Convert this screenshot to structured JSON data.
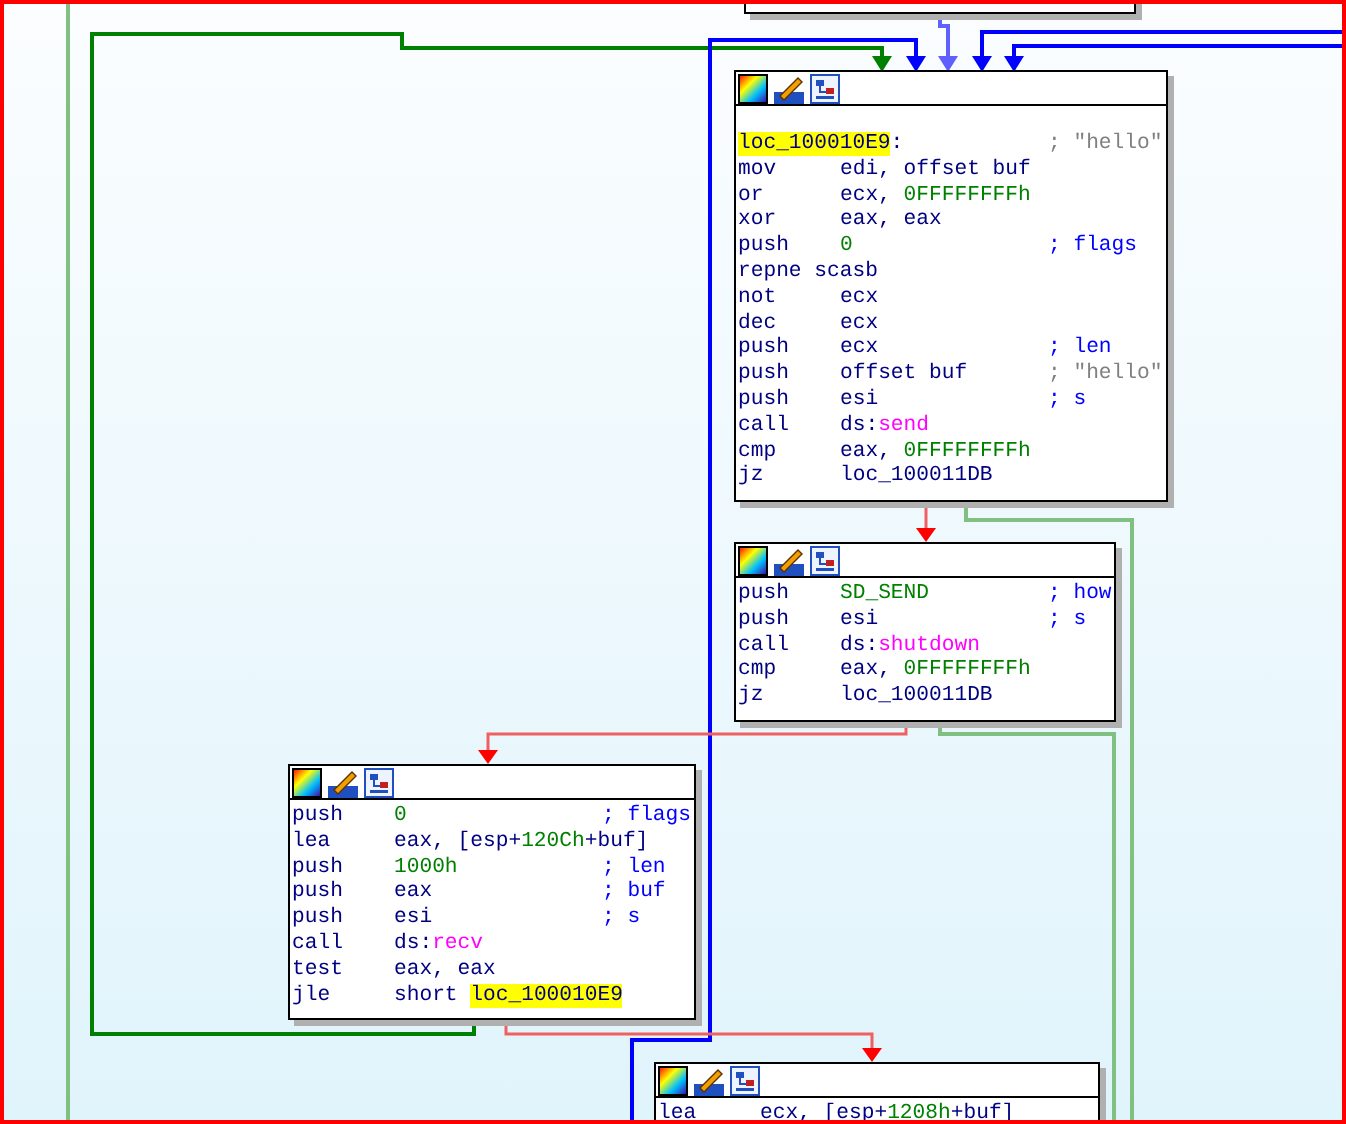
{
  "graph": {
    "blocks": [
      {
        "lines": [
          {
            "operands": [
              {
                "text": "loc_100010E9",
                "kind": "hl"
              },
              {
                "text": ":",
                "kind": "text"
              }
            ],
            "comment": {
              "text": "; \"hello\"",
              "kind": "string"
            }
          },
          {
            "mnemonic": "mov",
            "operands": [
              {
                "text": "edi, offset buf",
                "kind": "text"
              }
            ]
          },
          {
            "mnemonic": "or",
            "operands": [
              {
                "text": "ecx, ",
                "kind": "text"
              },
              {
                "text": "0FFFFFFFFh",
                "kind": "num"
              }
            ]
          },
          {
            "mnemonic": "xor",
            "operands": [
              {
                "text": "eax, eax",
                "kind": "text"
              }
            ]
          },
          {
            "mnemonic": "push",
            "operands": [
              {
                "text": "0",
                "kind": "num"
              }
            ],
            "comment": {
              "text": "; flags",
              "kind": "arg"
            }
          },
          {
            "mnemonic": "repne scasb"
          },
          {
            "mnemonic": "not",
            "operands": [
              {
                "text": "ecx",
                "kind": "text"
              }
            ]
          },
          {
            "mnemonic": "dec",
            "operands": [
              {
                "text": "ecx",
                "kind": "text"
              }
            ]
          },
          {
            "mnemonic": "push",
            "operands": [
              {
                "text": "ecx",
                "kind": "text"
              }
            ],
            "comment": {
              "text": "; len",
              "kind": "arg"
            }
          },
          {
            "mnemonic": "push",
            "operands": [
              {
                "text": "offset buf",
                "kind": "text"
              }
            ],
            "comment": {
              "text": "; \"hello\"",
              "kind": "string"
            }
          },
          {
            "mnemonic": "push",
            "operands": [
              {
                "text": "esi",
                "kind": "text"
              }
            ],
            "comment": {
              "text": "; s",
              "kind": "arg"
            }
          },
          {
            "mnemonic": "call",
            "operands": [
              {
                "text": "ds:",
                "kind": "text"
              },
              {
                "text": "send",
                "kind": "import"
              }
            ]
          },
          {
            "mnemonic": "cmp",
            "operands": [
              {
                "text": "eax, ",
                "kind": "text"
              },
              {
                "text": "0FFFFFFFFh",
                "kind": "num"
              }
            ]
          },
          {
            "mnemonic": "jz",
            "operands": [
              {
                "text": "loc_100011DB",
                "kind": "text"
              }
            ]
          }
        ]
      },
      {
        "lines": [
          {
            "mnemonic": "push",
            "operands": [
              {
                "text": "SD_SEND",
                "kind": "num"
              }
            ],
            "comment": {
              "text": "; how",
              "kind": "arg"
            }
          },
          {
            "mnemonic": "push",
            "operands": [
              {
                "text": "esi",
                "kind": "text"
              }
            ],
            "comment": {
              "text": "; s",
              "kind": "arg"
            }
          },
          {
            "mnemonic": "call",
            "operands": [
              {
                "text": "ds:",
                "kind": "text"
              },
              {
                "text": "shutdown",
                "kind": "import"
              }
            ]
          },
          {
            "mnemonic": "cmp",
            "operands": [
              {
                "text": "eax, ",
                "kind": "text"
              },
              {
                "text": "0FFFFFFFFh",
                "kind": "num"
              }
            ]
          },
          {
            "mnemonic": "jz",
            "operands": [
              {
                "text": "loc_100011DB",
                "kind": "text"
              }
            ]
          }
        ]
      },
      {
        "lines": [
          {
            "mnemonic": "push",
            "operands": [
              {
                "text": "0",
                "kind": "num"
              }
            ],
            "comment": {
              "text": "; flags",
              "kind": "arg"
            }
          },
          {
            "mnemonic": "lea",
            "operands": [
              {
                "text": "eax, [esp+",
                "kind": "text"
              },
              {
                "text": "120Ch",
                "kind": "num"
              },
              {
                "text": "+buf]",
                "kind": "text"
              }
            ]
          },
          {
            "mnemonic": "push",
            "operands": [
              {
                "text": "1000h",
                "kind": "num"
              }
            ],
            "comment": {
              "text": "; len",
              "kind": "arg"
            }
          },
          {
            "mnemonic": "push",
            "operands": [
              {
                "text": "eax",
                "kind": "text"
              }
            ],
            "comment": {
              "text": "; buf",
              "kind": "arg"
            }
          },
          {
            "mnemonic": "push",
            "operands": [
              {
                "text": "esi",
                "kind": "text"
              }
            ],
            "comment": {
              "text": "; s",
              "kind": "arg"
            }
          },
          {
            "mnemonic": "call",
            "operands": [
              {
                "text": "ds:",
                "kind": "text"
              },
              {
                "text": "recv",
                "kind": "import"
              }
            ]
          },
          {
            "mnemonic": "test",
            "operands": [
              {
                "text": "eax, eax",
                "kind": "text"
              }
            ]
          },
          {
            "mnemonic": "jle",
            "operands": [
              {
                "text": "short ",
                "kind": "text"
              },
              {
                "text": "loc_100010E9",
                "kind": "hl"
              }
            ]
          }
        ]
      },
      {
        "lines": [
          {
            "mnemonic": "lea",
            "operands": [
              {
                "text": "ecx, [esp+",
                "kind": "text"
              },
              {
                "text": "1208h",
                "kind": "num"
              },
              {
                "text": "+buf]",
                "kind": "text"
              }
            ]
          }
        ]
      }
    ]
  }
}
